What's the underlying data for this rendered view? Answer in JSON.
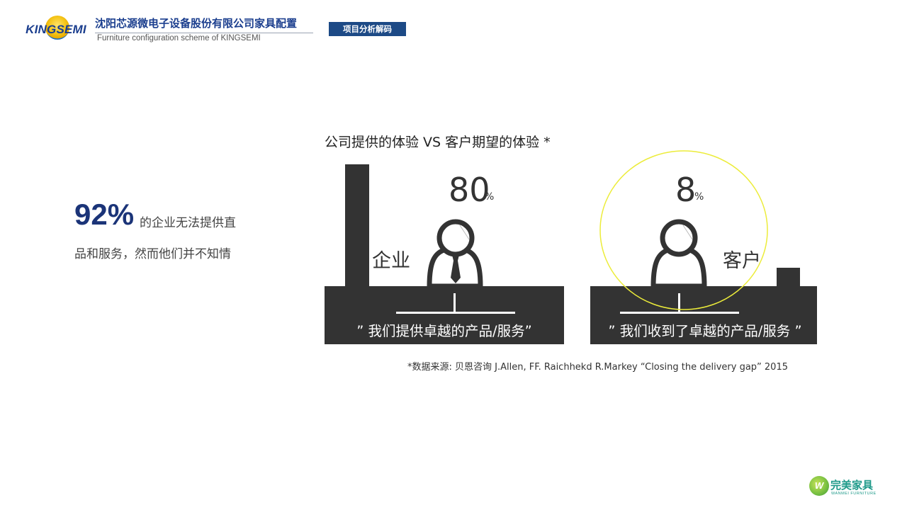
{
  "header": {
    "logo_text": "KINGSEMI",
    "company_name": "沈阳芯源微电子设备股份有限公司家具配置",
    "company_sub": "Furniture configuration scheme of KINGSEMI",
    "tag": "项目分析解码"
  },
  "left": {
    "big_pct": "92%",
    "line1": "的企业无法提供直",
    "line2": "品和服务，然而他们并不知情"
  },
  "diagram": {
    "title": "公司提供的体验 VS 客户期望的体验 *",
    "left_panel": {
      "value": "80",
      "unit": "%",
      "label": "企业",
      "quote": "” 我们提供卓越的产品/服务”"
    },
    "right_panel": {
      "value": "8",
      "unit": "%",
      "label": "客户",
      "quote": "” 我们收到了卓越的产品/服务 ”"
    },
    "colors": {
      "dark": "#333333",
      "highlight_circle": "#ecec3a"
    }
  },
  "source": "*数据来源: 贝恩咨询 J.Allen, FF. Raichhekd R.Markey “Closing the delivery gap” 2015",
  "footer_logo": {
    "mark": "W",
    "cn": "完美家具",
    "en": "WANMEI FURNITURE"
  }
}
